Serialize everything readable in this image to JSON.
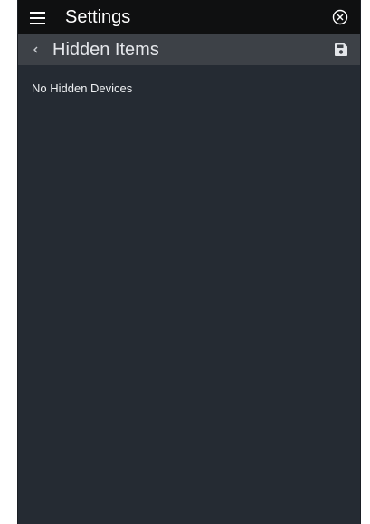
{
  "header": {
    "title": "Settings",
    "menu_icon": "hamburger-menu-icon",
    "close_icon": "close-circle-icon"
  },
  "subheader": {
    "title": "Hidden Items",
    "back_icon": "chevron-left-icon",
    "save_icon": "floppy-disk-save-icon"
  },
  "content": {
    "empty_message": "No Hidden Devices"
  },
  "colors": {
    "topbar_bg": "#0f1011",
    "subheader_bg": "#3d4147",
    "content_bg": "#252b33",
    "text": "#ffffff"
  }
}
